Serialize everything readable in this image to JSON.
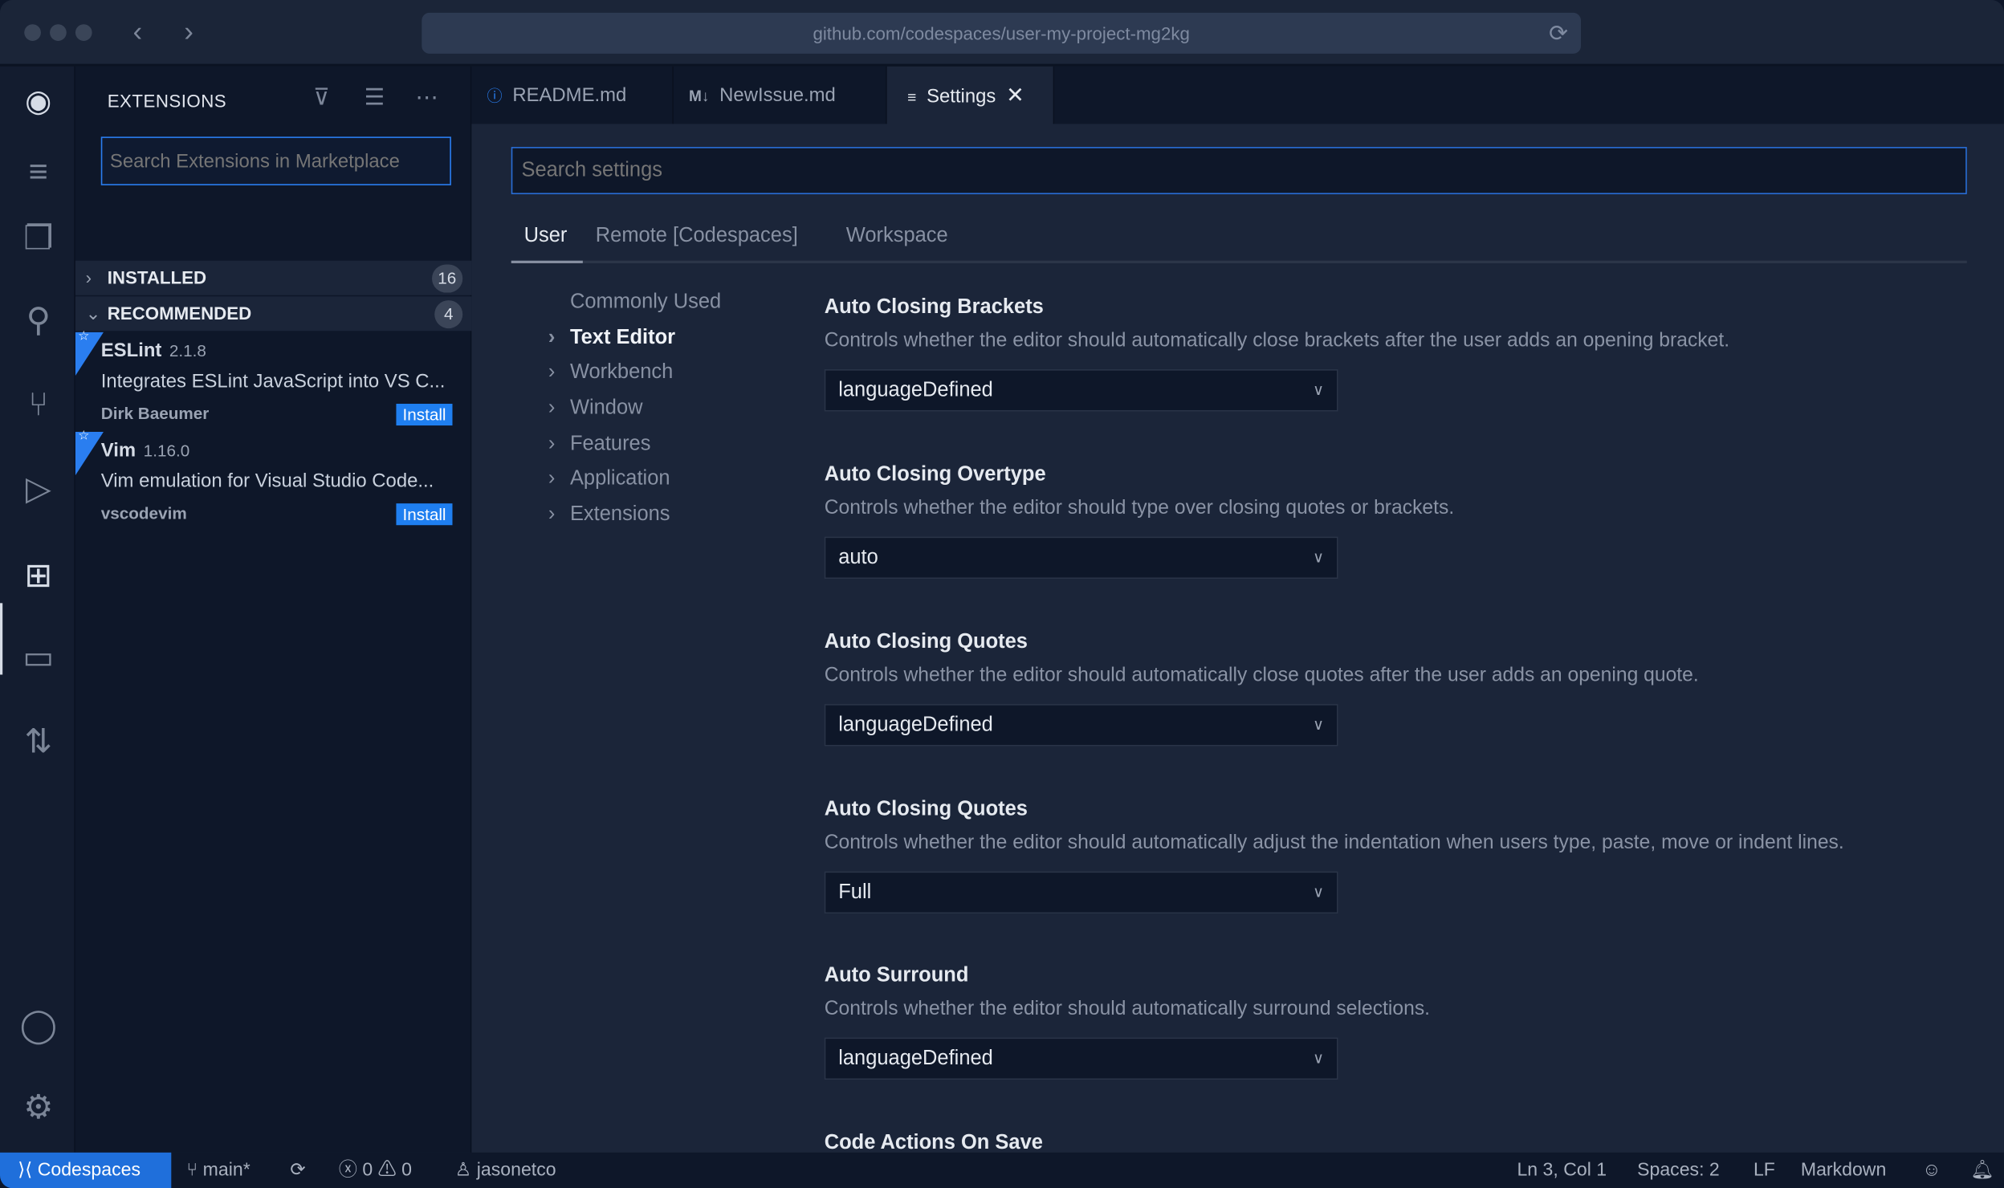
{
  "browser": {
    "url": "github.com/codespaces/user-my-project-mg2kg",
    "back": "‹",
    "forward": "›",
    "reload_icon": "reload-icon"
  },
  "activity_bar": {
    "items": [
      "menu",
      "explorer",
      "search",
      "source-control",
      "run-debug",
      "extensions",
      "remote-explorer",
      "pull-requests"
    ],
    "active": "extensions",
    "bottom": [
      "accounts",
      "settings"
    ]
  },
  "sidebar": {
    "title": "EXTENSIONS",
    "search_placeholder": "Search Extensions in Marketplace",
    "sections": [
      {
        "label": "INSTALLED",
        "count": "16",
        "expanded": false
      },
      {
        "label": "RECOMMENDED",
        "count": "4",
        "expanded": true
      }
    ],
    "extensions": [
      {
        "name": "ESLint",
        "version": "2.1.8",
        "description": "Integrates ESLint JavaScript into VS C...",
        "publisher": "Dirk Baeumer",
        "action": "Install"
      },
      {
        "name": "Vim",
        "version": "1.16.0",
        "description": "Vim emulation for Visual Studio Code...",
        "publisher": "vscodevim",
        "action": "Install"
      }
    ]
  },
  "tabs": [
    {
      "label": "README.md",
      "icon": "info-icon"
    },
    {
      "label": "NewIssue.md",
      "icon": "M↓"
    },
    {
      "label": "Settings",
      "icon": "settings-list-icon",
      "active": true
    }
  ],
  "settings": {
    "search_placeholder": "Search settings",
    "scopes": [
      {
        "label": "User",
        "active": true
      },
      {
        "label": "Remote [Codespaces]"
      },
      {
        "label": "Workspace"
      }
    ],
    "toc": [
      {
        "label": "Commonly Used"
      },
      {
        "label": "Text Editor",
        "bold": true
      },
      {
        "label": "Workbench"
      },
      {
        "label": "Window"
      },
      {
        "label": "Features"
      },
      {
        "label": "Application"
      },
      {
        "label": "Extensions"
      }
    ],
    "items": [
      {
        "title": "Auto Closing Brackets",
        "description": "Controls whether the editor should automatically close brackets after the user adds an opening bracket.",
        "value": "languageDefined"
      },
      {
        "title": "Auto Closing Overtype",
        "description": "Controls whether the editor should type over closing quotes or brackets.",
        "value": "auto"
      },
      {
        "title": "Auto Closing Quotes",
        "description": "Controls whether the editor should automatically close quotes after the user adds an opening quote.",
        "value": "languageDefined"
      },
      {
        "title": "Auto Closing Quotes",
        "description": "Controls whether the editor should automatically adjust the indentation when users type, paste, move or indent lines.",
        "value": "Full"
      },
      {
        "title": "Auto Surround",
        "description": "Controls whether the editor should automatically surround selections.",
        "value": "languageDefined"
      },
      {
        "title": "Code Actions On Save"
      }
    ]
  },
  "status": {
    "remote": "Codespaces",
    "branch": "main*",
    "errors": "0",
    "warnings": "0",
    "user": "jasonetco",
    "position": "Ln 3, Col 1",
    "spaces": "Spaces: 2",
    "eol": "LF",
    "language": "Markdown"
  },
  "colors": {
    "accent": "#2a7ef0",
    "remote_bg": "#1f6fdb",
    "editor_bg": "#1b2539",
    "sidebar_bg": "#0e1729"
  }
}
